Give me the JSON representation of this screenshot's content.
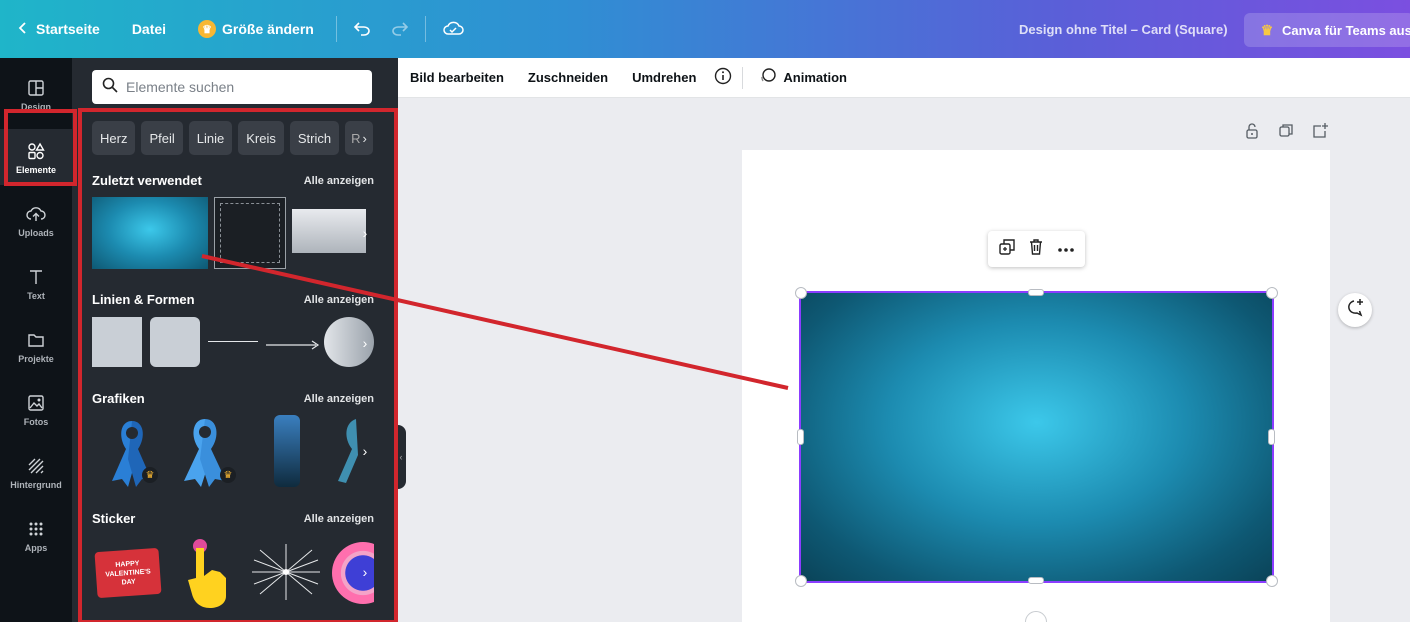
{
  "topbar": {
    "home": "Startseite",
    "file": "Datei",
    "resize": "Größe ändern",
    "design_title": "Design ohne Titel – Card (Square)",
    "teams": "Canva für Teams aus"
  },
  "rail": {
    "items": [
      {
        "label": "Design",
        "icon": "layout-icon"
      },
      {
        "label": "Elemente",
        "icon": "shapes-icon"
      },
      {
        "label": "Uploads",
        "icon": "cloud-upload-icon"
      },
      {
        "label": "Text",
        "icon": "text-icon"
      },
      {
        "label": "Projekte",
        "icon": "folder-icon"
      },
      {
        "label": "Fotos",
        "icon": "image-icon"
      },
      {
        "label": "Hintergrund",
        "icon": "pattern-icon"
      },
      {
        "label": "Apps",
        "icon": "grid-icon"
      }
    ]
  },
  "panel": {
    "search_placeholder": "Elemente suchen",
    "chips": [
      "Herz",
      "Pfeil",
      "Linie",
      "Kreis",
      "Strich",
      "R"
    ],
    "see_all": "Alle anzeigen",
    "sections": {
      "recent": "Zuletzt verwendet",
      "lines_shapes": "Linien & Formen",
      "graphics": "Grafiken",
      "stickers": "Sticker"
    },
    "sticker_text": [
      "HAPPY",
      "VALENTINE'S",
      "DAY"
    ]
  },
  "toolbar": {
    "edit_image": "Bild bearbeiten",
    "crop": "Zuschneiden",
    "flip": "Umdrehen",
    "animation": "Animation"
  },
  "colors": {
    "accent": "#8b3dff",
    "annotation": "#d2262d",
    "panel_bg": "#252a31",
    "rail_bg": "#0e1318"
  }
}
